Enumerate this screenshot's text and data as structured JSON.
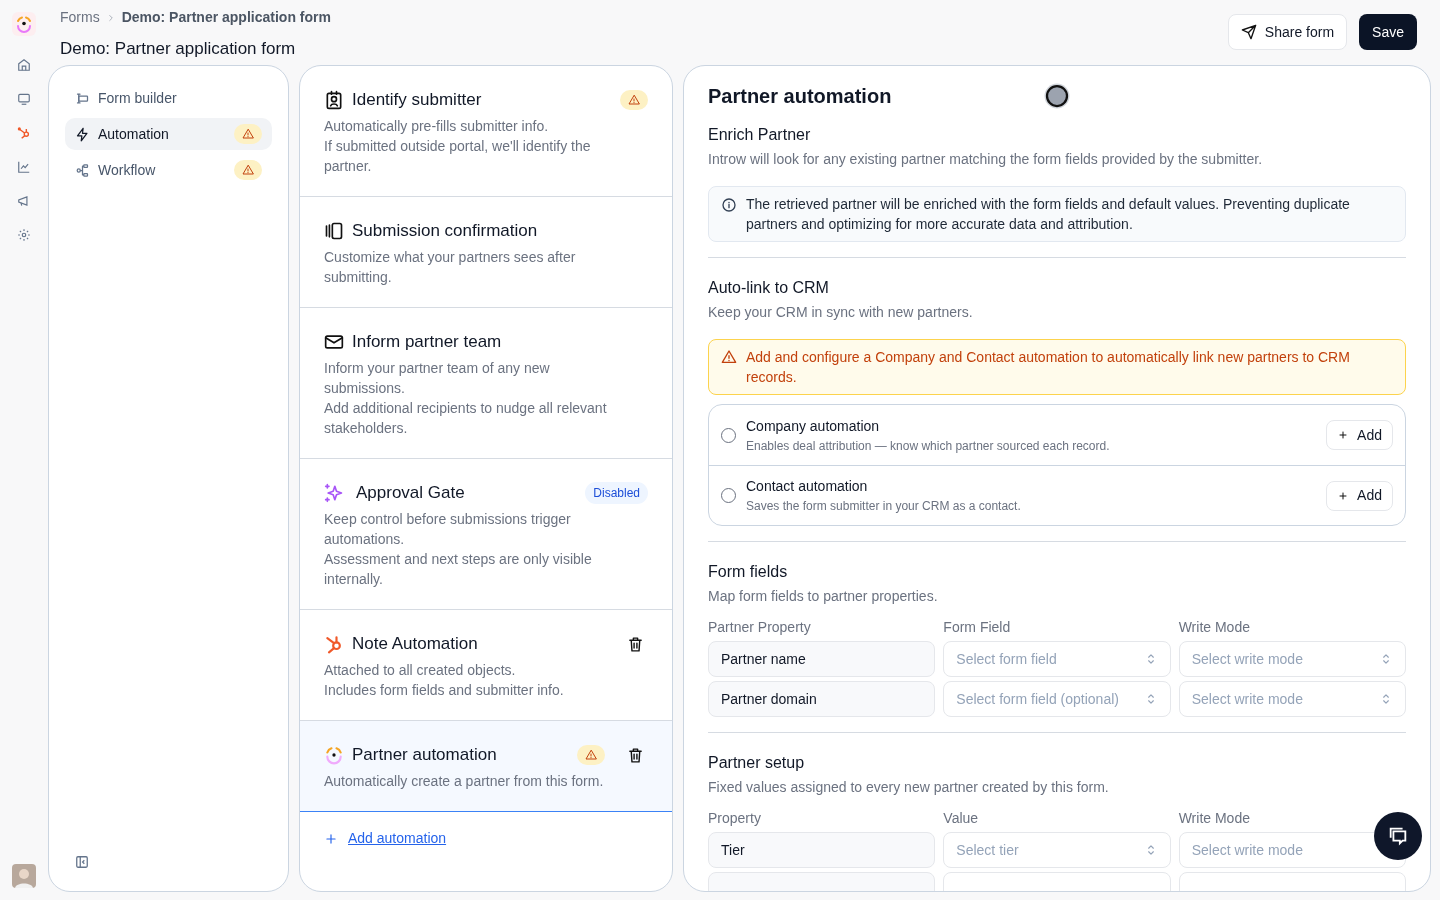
{
  "breadcrumb": [
    {
      "label": "Forms"
    },
    {
      "label": "Demo: Partner application form"
    }
  ],
  "page_title": "Demo: Partner application form",
  "header_buttons": [
    {
      "kind": "share",
      "label": "Share form"
    },
    {
      "kind": "save",
      "label": "Save"
    }
  ],
  "nav": {
    "items": [
      {
        "kind": "form",
        "label": "Form builder",
        "selected": false,
        "warning": false
      },
      {
        "kind": "bolt",
        "label": "Automation",
        "selected": true,
        "warning": true
      },
      {
        "kind": "flow",
        "label": "Workflow",
        "selected": false,
        "warning": true
      }
    ]
  },
  "automations": {
    "items": [
      {
        "kind": "badge",
        "title": "Identify submitter",
        "description": "Automatically pre-fills submitter info.\nIf submitted outside portal, we'll identify the partner.",
        "warning": true,
        "deletable": false,
        "selected": false
      },
      {
        "kind": "screen",
        "title": "Submission confirmation",
        "description": "Customize what your partners sees after submitting.",
        "warning": false,
        "deletable": false,
        "selected": false
      },
      {
        "kind": "mail",
        "title": "Inform partner team",
        "description": "Inform your partner team of any new submissions.\nAdd additional recipients to nudge all relevant stakeholders.",
        "warning": false,
        "deletable": false,
        "selected": false
      },
      {
        "kind": "sparkle",
        "title": "Approval Gate",
        "badge": "Disabled",
        "description": "Keep control before submissions trigger automations.\nAssessment and next steps are only visible internally.",
        "warning": false,
        "deletable": false,
        "selected": false
      },
      {
        "kind": "hub",
        "title": "Note Automation",
        "description": "Attached to all created objects.\nIncludes form fields and submitter info.",
        "warning": false,
        "deletable": true,
        "selected": false
      },
      {
        "kind": "logo",
        "title": "Partner automation",
        "description": "Automatically create a partner from this form.",
        "warning": true,
        "deletable": true,
        "selected": true
      }
    ],
    "add_link": "Add automation"
  },
  "detail": {
    "title": "Partner automation",
    "enrich": {
      "heading": "Enrich Partner",
      "description": "Introw will look for any existing partner matching the form fields provided by the submitter.",
      "note": "The retrieved partner will be enriched with the form fields and default values. Preventing duplicate partners and optimizing for more accurate data and attribution."
    },
    "crm": {
      "heading": "Auto-link to CRM",
      "description": "Keep your CRM in sync with new partners.",
      "warning": "Add and configure a Company and Contact automation to automatically link new partners to CRM records.",
      "options": [
        {
          "title": "Company automation",
          "description": "Enables deal attribution — know which partner sourced each record.",
          "checked": false,
          "button": "Add"
        },
        {
          "title": "Contact automation",
          "description": "Saves the form submitter in your CRM as a contact.",
          "checked": false,
          "button": "Add"
        }
      ]
    },
    "tables": [
      {
        "heading": "Form fields",
        "description": "Map form fields to partner properties.",
        "columns": [
          "Partner Property",
          "Form Field",
          "Write Mode"
        ],
        "rows": [
          [
            "Partner name",
            {
              "placeholder": "Select form field"
            },
            {
              "placeholder": "Select write mode"
            }
          ],
          [
            "Partner domain",
            {
              "placeholder": "Select form field (optional)"
            },
            {
              "placeholder": "Select write mode"
            }
          ]
        ]
      },
      {
        "heading": "Partner setup",
        "description": "Fixed values assigned to every new partner created by this form.",
        "columns": [
          "Property",
          "Value",
          "Write Mode"
        ],
        "rows": [
          [
            "Tier",
            {
              "placeholder": "Select tier"
            },
            {
              "placeholder": "Select write mode"
            }
          ]
        ],
        "cut_row": [
          {
            "kind": "property"
          },
          {
            "kind": "select"
          },
          {
            "kind": "select"
          }
        ]
      }
    ]
  }
}
